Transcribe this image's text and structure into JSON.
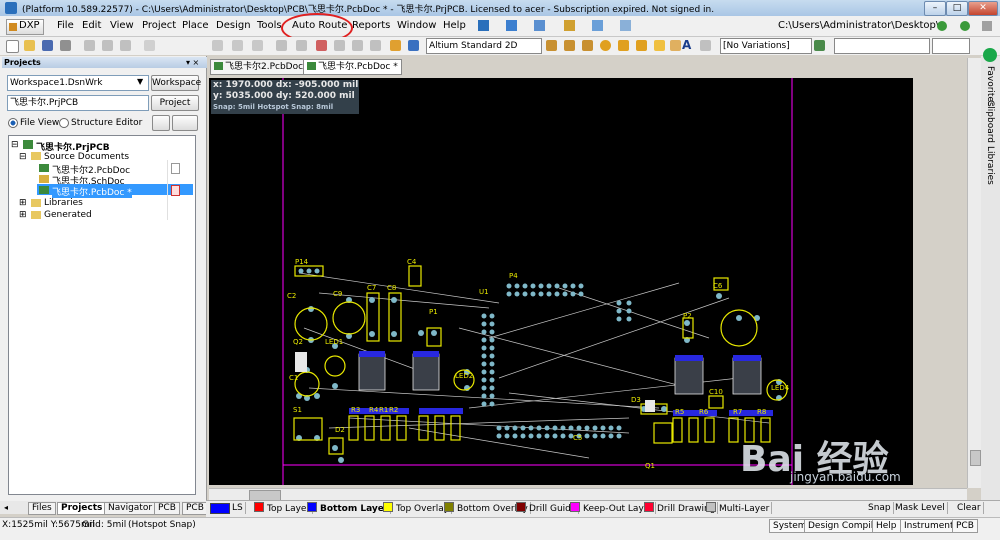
{
  "window": {
    "title": "(Platform 10.589.22577) - C:\\Users\\Administrator\\Desktop\\PCB\\飞思卡尔.PcbDoc * - 飞思卡尔.PrjPCB. Licensed to acer - Subscription expired. Not signed in.",
    "minimize": "–",
    "maximize": "□",
    "close": "✕"
  },
  "menu": {
    "dxp": "DXP",
    "items": [
      "File",
      "Edit",
      "View",
      "Project",
      "Place",
      "Design",
      "Tools",
      "Auto Route",
      "Reports",
      "Window",
      "Help"
    ],
    "path": "C:\\Users\\Administrator\\Desktop\\"
  },
  "toolbar": {
    "view_combo": "Altium Standard 2D",
    "variation_combo": "[No Variations]"
  },
  "projects_panel": {
    "header": "Projects",
    "workspace_value": "Workspace1.DsnWrk",
    "workspace_button": "Workspace",
    "project_value": "飞思卡尔.PrjPCB",
    "project_button": "Project",
    "view_file": "File View",
    "view_structure": "Structure Editor",
    "tree": {
      "project": "飞思卡尔.PrjPCB",
      "source_folder": "Source Documents",
      "docs": [
        "飞思卡尔2.PcbDoc",
        "飞思卡尔.SchDoc",
        "飞思卡尔.PcbDoc *"
      ],
      "libraries": "Libraries",
      "generated": "Generated"
    }
  },
  "doc_tabs": [
    "飞思卡尔2.PcbDoc",
    "飞思卡尔.PcbDoc *"
  ],
  "readout": {
    "line1": "x: 1970.000  dx:  -905.000 mil",
    "line2": "y: 5035.000  dy:  520.000 mil",
    "line3": "Snap: 5mil Hotspot Snap: 8mil"
  },
  "pcb_labels": [
    "P14",
    "C4",
    "P4",
    "C2",
    "C9",
    "C7",
    "C8",
    "U1",
    "P1",
    "LED1",
    "C1",
    "LED2",
    "S1",
    "R3",
    "R4",
    "R1",
    "R2",
    "D2",
    "D3",
    "C5",
    "C6",
    "P2",
    "LED4",
    "C10",
    "R5",
    "R6",
    "R7",
    "R8",
    "Q1",
    "Q2"
  ],
  "side_tabs": [
    "Favorites",
    "Clipboard",
    "Libraries"
  ],
  "bottom_tabs": [
    "Files",
    "Projects",
    "Navigator",
    "PCB",
    "PCB F"
  ],
  "layers": [
    {
      "name": "LS",
      "color": "#0000ff"
    },
    {
      "name": "Top Layer",
      "color": "#ff0000"
    },
    {
      "name": "Bottom Layer",
      "color": "#0000ff"
    },
    {
      "name": "Top Overlay",
      "color": "#ffff00"
    },
    {
      "name": "Bottom Overlay",
      "color": "#808000"
    },
    {
      "name": "Drill Guide",
      "color": "#800000"
    },
    {
      "name": "Keep-Out Layer",
      "color": "#ff00ff"
    },
    {
      "name": "Drill Drawing",
      "color": "#ff0030"
    },
    {
      "name": "Multi-Layer",
      "color": "#c0c0c0"
    }
  ],
  "layer_actions": [
    "Snap",
    "Mask Level",
    "Clear"
  ],
  "status": {
    "coords": "X:1525mil Y:5675mil",
    "grid": "Grid: 5mil",
    "snap": "(Hotspot Snap)",
    "buttons": [
      "System",
      "Design Compiler",
      "Help",
      "Instruments",
      "PCB"
    ]
  },
  "watermark": {
    "brand": "Bai 经验",
    "url": "jingyan.baidu.com"
  }
}
